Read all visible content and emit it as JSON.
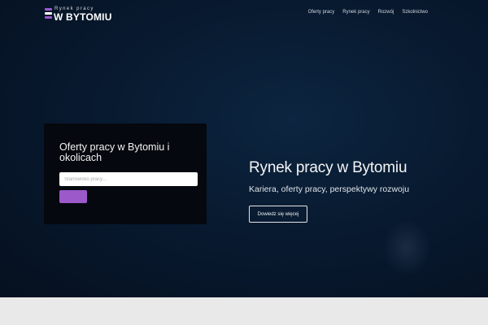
{
  "header": {
    "logo_top": "Rynek pracy",
    "logo_main": "W BYTOMIU",
    "nav": [
      "Oferty pracy",
      "Rynek pracy",
      "Rozwój",
      "Szkolnictwo"
    ]
  },
  "search": {
    "title": "Oferty pracy w Bytomiu i okolicach",
    "placeholder": "Stanowisko pracy...",
    "button_label": ""
  },
  "hero": {
    "title": "Rynek pracy w Bytomiu",
    "subtitle": "Kariera, oferty pracy, perspektywy rozwoju",
    "button_label": "Dowiedz się więcej"
  },
  "colors": {
    "accent": "#9b59c9",
    "hero_background": "#081a30",
    "card_background": "#05080e"
  }
}
